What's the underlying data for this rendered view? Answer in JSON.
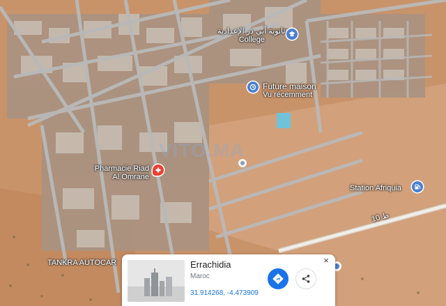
{
  "map": {
    "pins": [
      {
        "name": "college-label",
        "lines": [
          "ثانوية أبي ذر الإعدادية",
          "College"
        ],
        "icon": "school-icon",
        "color": "#4a80d0"
      },
      {
        "name": "future-maison-label",
        "lines": [
          "Future maison",
          "Vu récemment"
        ],
        "icon": "history-icon",
        "color": "#4a80d0"
      },
      {
        "name": "pharmacie-label",
        "lines": [
          "Pharmacie Riad",
          "Al Omrane"
        ],
        "icon": "pharmacy-icon",
        "color": "#e94235"
      },
      {
        "name": "station-label",
        "lines": [
          "Station Afriquia"
        ],
        "icon": "fuel-icon",
        "color": "#4a80d0"
      },
      {
        "name": "tankra-label",
        "lines": [
          "TANKRA AUTOCAR"
        ],
        "icon": "",
        "color": ""
      }
    ],
    "road_label": "ط 10",
    "road_number": "10"
  },
  "place_card": {
    "title": "Errachidia",
    "subtitle": "Maroc",
    "coords": "31.914268, -4.473909",
    "close_label": "×",
    "directions_icon": "directions-icon",
    "share_icon": "share-icon"
  },
  "colors": {
    "accent": "#1a73e8",
    "terrain": "#c9936a",
    "road": "#b9b9b9",
    "pharmacy": "#e94235"
  }
}
